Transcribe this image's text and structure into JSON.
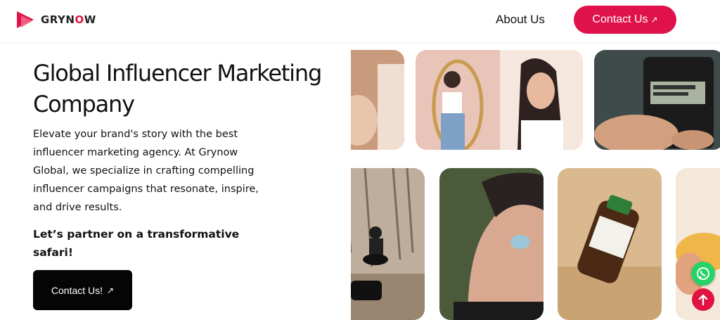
{
  "header": {
    "logo": {
      "text_main": "GRYN",
      "text_accent": "O",
      "text_end": "W"
    },
    "nav": {
      "about_label": "About Us",
      "contact_label": "Contact Us",
      "contact_arrow": "↗"
    }
  },
  "hero": {
    "title": "Global Influencer Marketing Company",
    "description": "Elevate your brand's story with the best influencer marketing agency. At Grynow Global, we specialize in crafting compelling influencer campaigns that resonate, inspire, and drive results.",
    "cta_text": "Let’s partner on a transformative safari!",
    "button_label": "Contact Us!",
    "button_arrow": "↗"
  },
  "gallery": {
    "tiles": [
      {
        "id": "influencer-partial-left",
        "subject": "influencer-photo"
      },
      {
        "id": "influencer-mirror-selfie",
        "subject": "influencer-photo"
      },
      {
        "id": "calculator-hands",
        "subject": "product-photo"
      },
      {
        "id": "motorbike-forest",
        "subject": "lifestyle-photo"
      },
      {
        "id": "earbud-closeup",
        "subject": "product-photo"
      },
      {
        "id": "moringa-bottle",
        "subject": "product-photo"
      },
      {
        "id": "food-partial-right",
        "subject": "product-photo"
      }
    ]
  },
  "floating": {
    "whatsapp_icon": "whatsapp-icon",
    "scroll_top_icon": "arrow-up-icon"
  },
  "colors": {
    "brand": "#e0124b",
    "button_dark": "#050505",
    "whatsapp": "#25d366"
  }
}
